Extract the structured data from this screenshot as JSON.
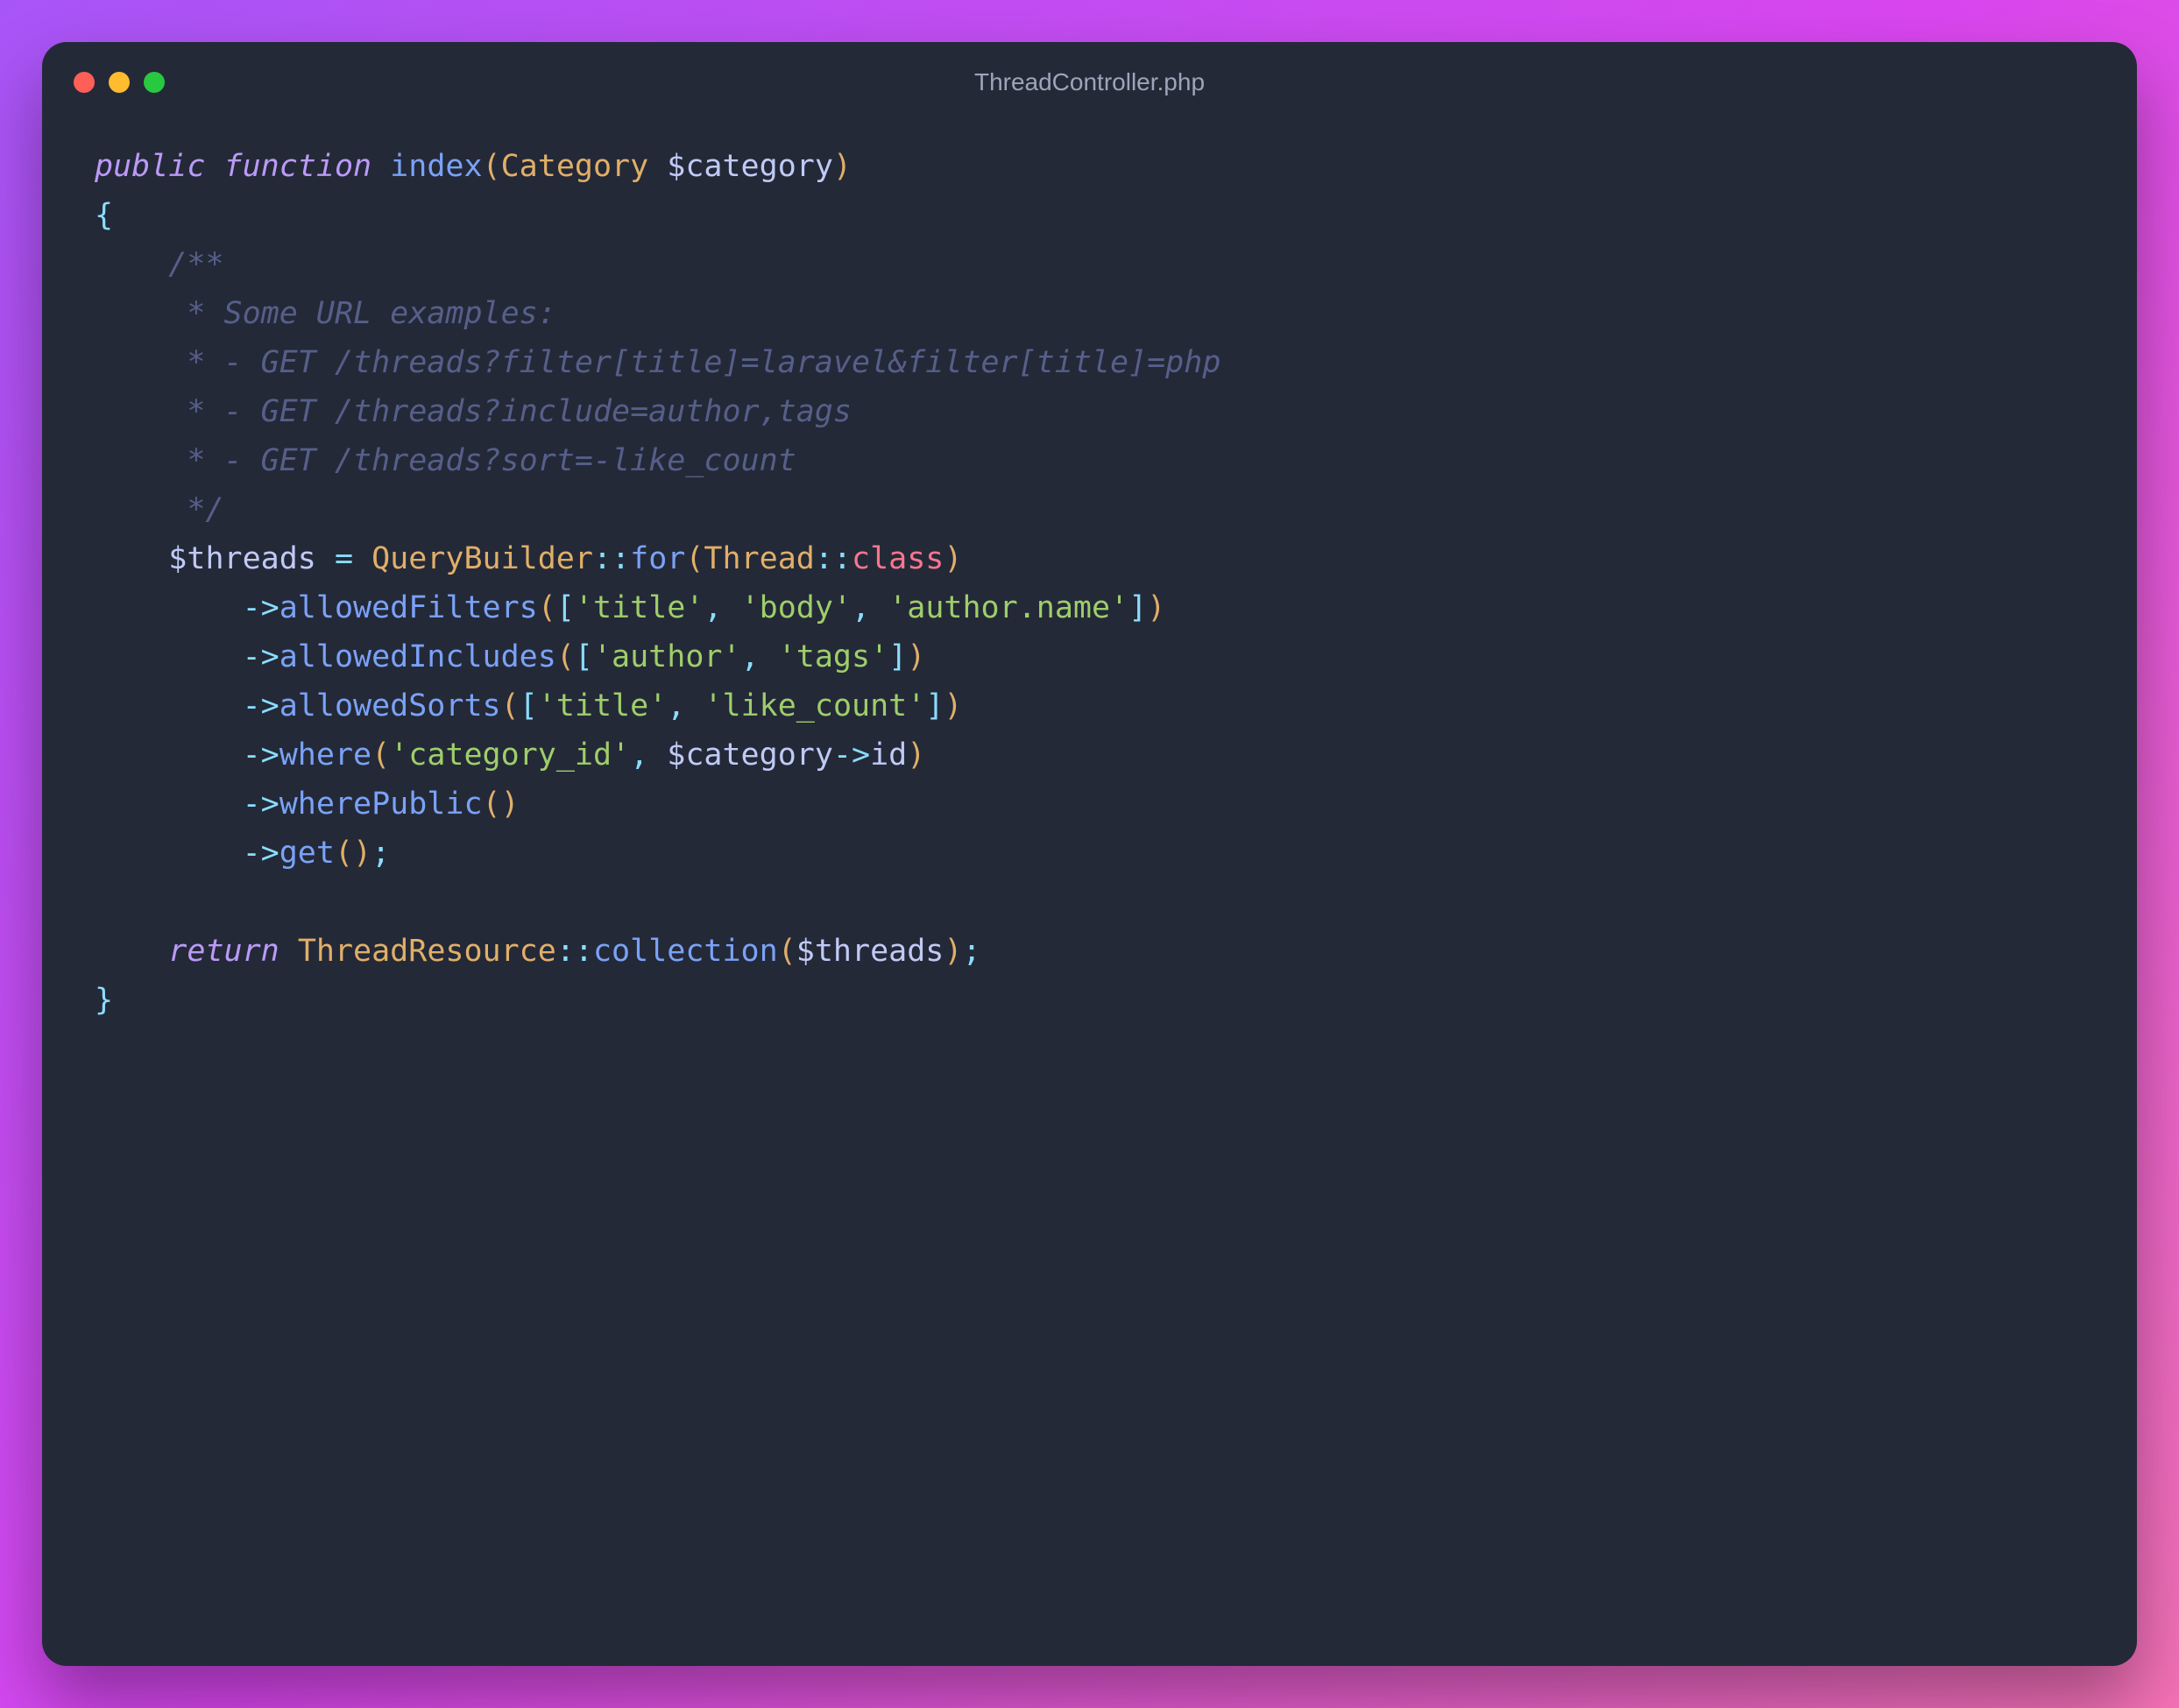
{
  "window": {
    "title": "ThreadController.php"
  },
  "code": {
    "line1": {
      "public": "public",
      "function": "function",
      "name": "index",
      "lparen": "(",
      "param_type": "Category",
      "space": " ",
      "param_var": "$category",
      "rparen": ")"
    },
    "line2": {
      "brace": "{"
    },
    "line3": {
      "text": "/**"
    },
    "line4": {
      "text": " * Some URL examples:"
    },
    "line5": {
      "text": " * - GET /threads?filter[title]=laravel&filter[title]=php"
    },
    "line6": {
      "text": " * - GET /threads?include=author,tags"
    },
    "line7": {
      "text": " * - GET /threads?sort=-like_count"
    },
    "line8": {
      "text": " */"
    },
    "line9": {
      "var": "$threads",
      "eq": " = ",
      "class": "QueryBuilder",
      "sep": "::",
      "method": "for",
      "lparen": "(",
      "arg_class": "Thread",
      "arg_sep": "::",
      "arg_kw": "class",
      "rparen": ")"
    },
    "line10": {
      "arrow": "->",
      "method": "allowedFilters",
      "lparen": "(",
      "lbracket": "[",
      "s1": "'title'",
      "comma1": ", ",
      "s2": "'body'",
      "comma2": ", ",
      "s3": "'author.name'",
      "rbracket": "]",
      "rparen": ")"
    },
    "line11": {
      "arrow": "->",
      "method": "allowedIncludes",
      "lparen": "(",
      "lbracket": "[",
      "s1": "'author'",
      "comma1": ", ",
      "s2": "'tags'",
      "rbracket": "]",
      "rparen": ")"
    },
    "line12": {
      "arrow": "->",
      "method": "allowedSorts",
      "lparen": "(",
      "lbracket": "[",
      "s1": "'title'",
      "comma1": ", ",
      "s2": "'like_count'",
      "rbracket": "]",
      "rparen": ")"
    },
    "line13": {
      "arrow": "->",
      "method": "where",
      "lparen": "(",
      "s1": "'category_id'",
      "comma": ", ",
      "var": "$category",
      "obj_arrow": "->",
      "prop": "id",
      "rparen": ")"
    },
    "line14": {
      "arrow": "->",
      "method": "wherePublic",
      "lparen": "(",
      "rparen": ")"
    },
    "line15": {
      "arrow": "->",
      "method": "get",
      "lparen": "(",
      "rparen": ")",
      "semi": ";"
    },
    "line16": {
      "return": "return",
      "space": " ",
      "class": "ThreadResource",
      "sep": "::",
      "method": "collection",
      "lparen": "(",
      "var": "$threads",
      "rparen": ")",
      "semi": ";"
    },
    "line17": {
      "brace": "}"
    }
  }
}
